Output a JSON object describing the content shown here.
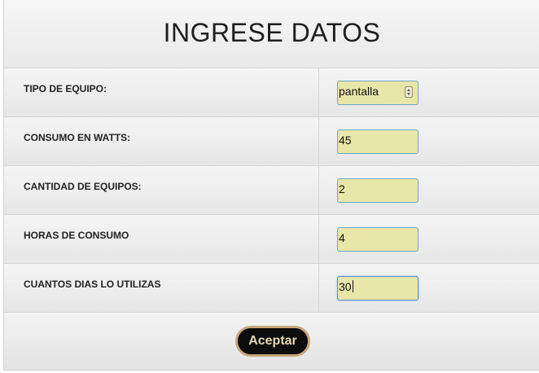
{
  "form": {
    "title": "INGRESE DATOS",
    "rows": [
      {
        "label": "TIPO DE EQUIPO:",
        "value": "pantalla",
        "type": "select"
      },
      {
        "label": "CONSUMO EN WATTS:",
        "value": "45",
        "type": "text"
      },
      {
        "label": "CANTIDAD DE EQUIPOS:",
        "value": "2",
        "type": "text"
      },
      {
        "label": "HORAS DE CONSUMO",
        "value": "4",
        "type": "text"
      },
      {
        "label": "CUANTOS DIAS LO UTILIZAS",
        "value": "30",
        "type": "text",
        "focused": true
      }
    ],
    "submit_label": "Aceptar"
  },
  "colors": {
    "field_background": "#e9e6aa",
    "field_border": "#6aa7c4",
    "button_background": "#0c0c0c",
    "button_border": "#c9a678",
    "button_text": "#e9d6b2"
  },
  "icons": {
    "select_toggle": "updown-arrows-icon"
  }
}
